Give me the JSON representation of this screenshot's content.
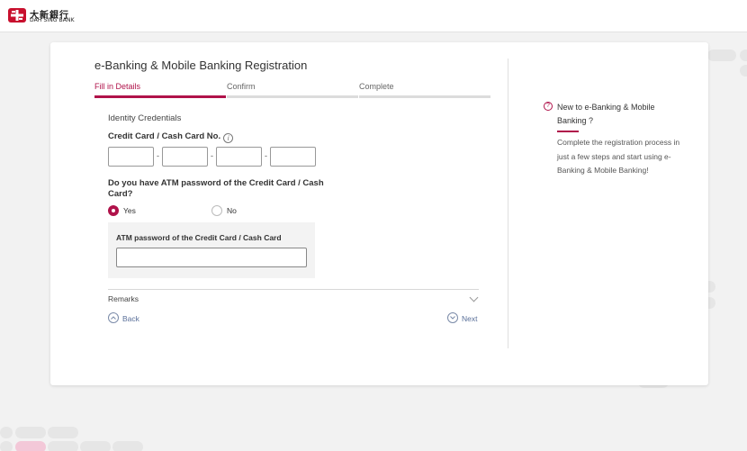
{
  "brand": {
    "name_cn": "大新銀行",
    "name_en": "DAH SING BANK"
  },
  "colors": {
    "accent": "#b0124a",
    "link": "#5a6f99"
  },
  "page": {
    "title": "e-Banking & Mobile Banking Registration"
  },
  "steps": [
    {
      "label": "Fill in Details",
      "active": true
    },
    {
      "label": "Confirm",
      "active": false
    },
    {
      "label": "Complete",
      "active": false
    }
  ],
  "form": {
    "section_title": "Identity Credentials",
    "card_label": "Credit Card / Cash Card No.",
    "info_icon": "i",
    "card_segments": [
      "",
      "",
      "",
      ""
    ],
    "question": "Do you have ATM password of the Credit Card / Cash Card?",
    "options": [
      {
        "label": "Yes",
        "checked": true
      },
      {
        "label": "No",
        "checked": false
      }
    ],
    "atm_label": "ATM password of the Credit Card / Cash Card",
    "atm_value": "",
    "remarks_label": "Remarks"
  },
  "nav": {
    "back_label": "Back",
    "next_label": "Next"
  },
  "sidebar": {
    "icon": "?",
    "title": "New to e-Banking & Mobile Banking ?",
    "text": "Complete the registration process in just a few steps and start using e-Banking & Mobile Banking!"
  }
}
